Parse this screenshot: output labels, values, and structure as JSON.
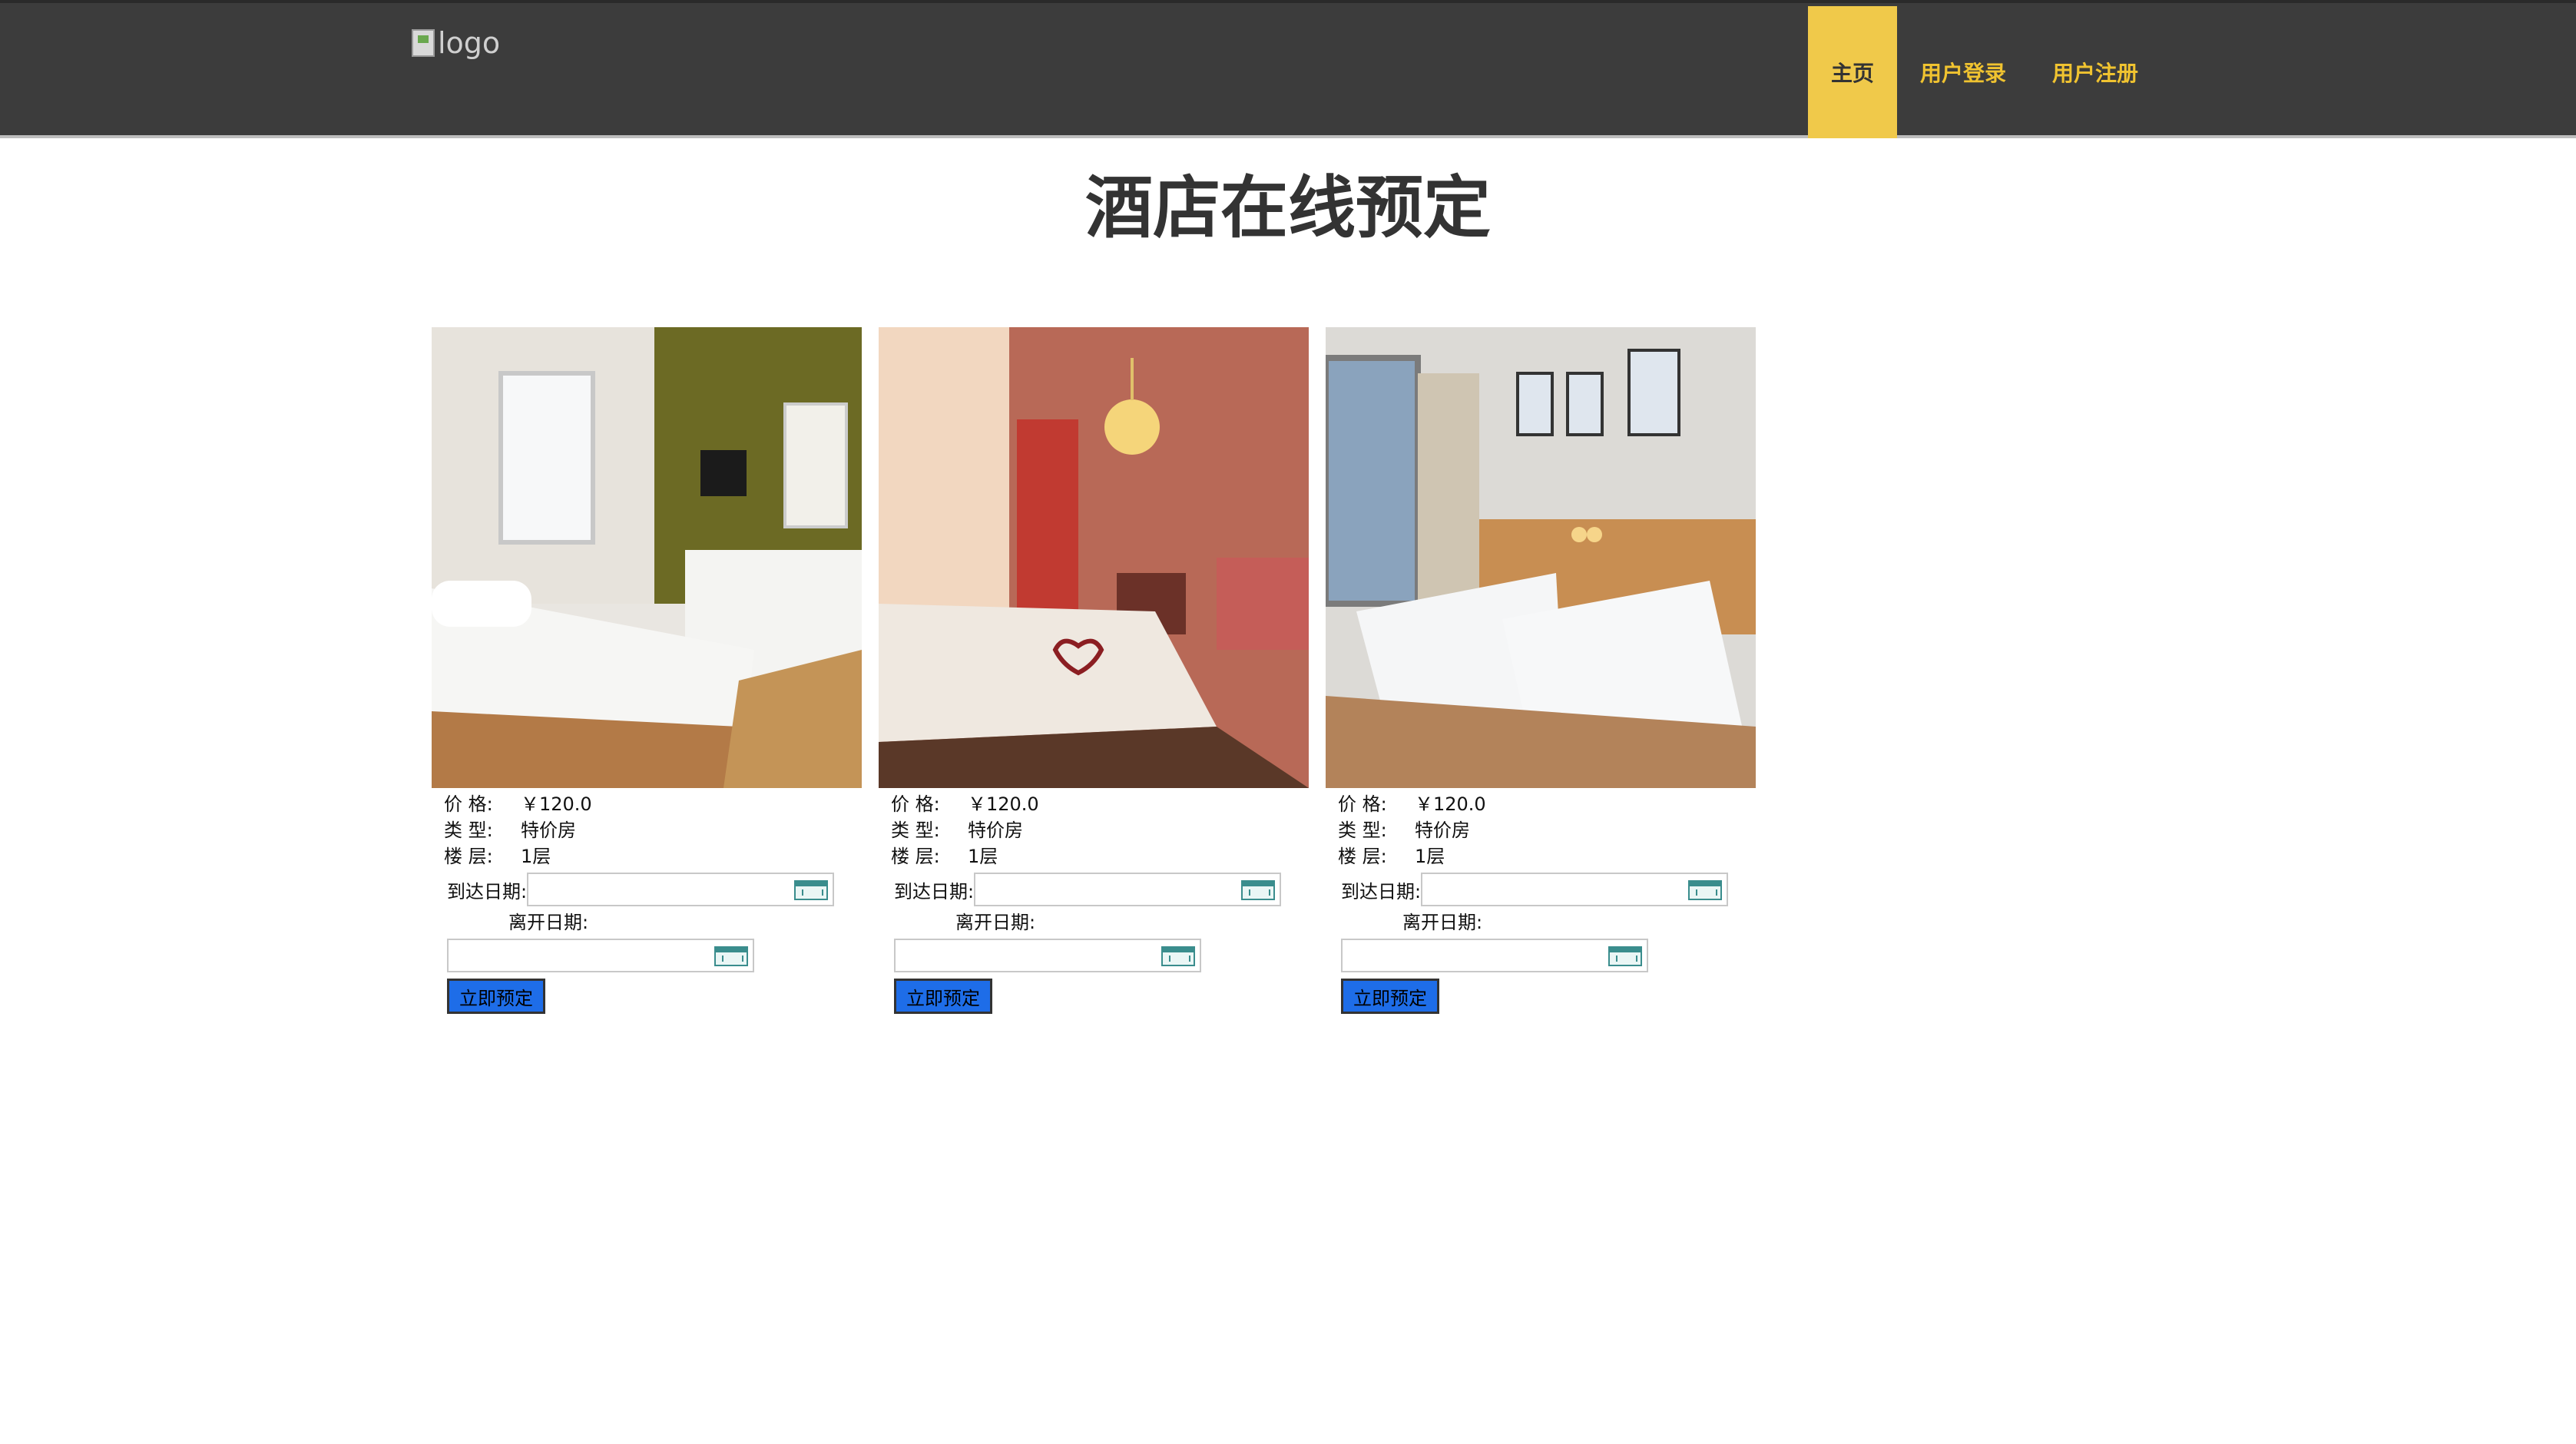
{
  "header": {
    "logo_alt": "logo",
    "nav": [
      {
        "label": "主页",
        "active": true
      },
      {
        "label": "用户登录",
        "active": false
      },
      {
        "label": "用户注册",
        "active": false
      }
    ],
    "accent_color": "#f0c94a",
    "bar_color": "#3c3c3c"
  },
  "page_title": "酒店在线预定",
  "rooms": [
    {
      "price_label": "价 格:",
      "price": "￥120.0",
      "type_label": "类 型:",
      "type": "特价房",
      "floor_label": "楼 层:",
      "floor": "1层",
      "arrive_label": "到达日期:",
      "arrive_value": "",
      "leave_label": "离开日期:",
      "leave_value": "",
      "book_label": "立即预定"
    },
    {
      "price_label": "价 格:",
      "price": "￥120.0",
      "type_label": "类 型:",
      "type": "特价房",
      "floor_label": "楼 层:",
      "floor": "1层",
      "arrive_label": "到达日期:",
      "arrive_value": "",
      "leave_label": "离开日期:",
      "leave_value": "",
      "book_label": "立即预定"
    },
    {
      "price_label": "价 格:",
      "price": "￥120.0",
      "type_label": "类 型:",
      "type": "特价房",
      "floor_label": "楼 层:",
      "floor": "1层",
      "arrive_label": "到达日期:",
      "arrive_value": "",
      "leave_label": "离开日期:",
      "leave_value": "",
      "book_label": "立即预定"
    }
  ],
  "button_color": "#1e6de8"
}
